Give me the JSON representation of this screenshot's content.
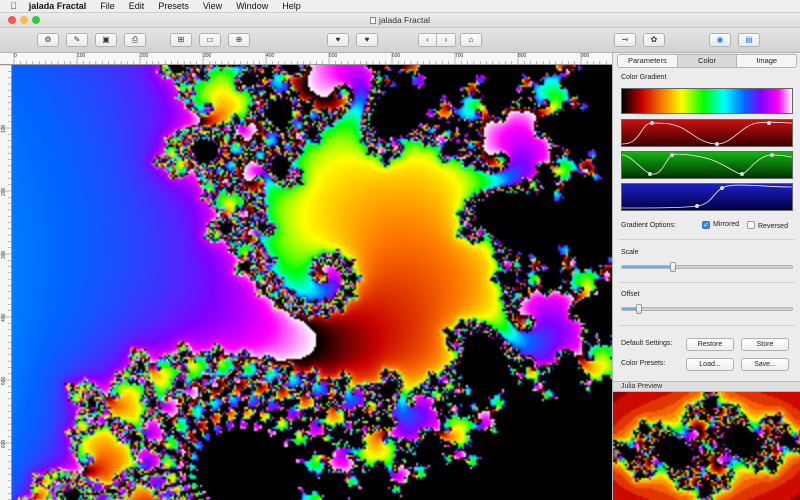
{
  "menubar": {
    "apple_icon": "apple-logo",
    "items": [
      "jalada Fractal",
      "File",
      "Edit",
      "Presets",
      "View",
      "Window",
      "Help"
    ]
  },
  "window": {
    "title": "jalada Fractal",
    "traffic_light_colors": {
      "close": "#fc5753",
      "minimize": "#fdbc40",
      "zoom": "#33c748"
    }
  },
  "toolbar": {
    "buttons": [
      {
        "name": "open-icon",
        "glyph": "⚙"
      },
      {
        "name": "edit-icon",
        "glyph": "✎"
      },
      {
        "name": "save-icon",
        "glyph": "▣"
      },
      {
        "name": "print-icon",
        "glyph": "⎙"
      },
      {
        "name": "export-icon",
        "glyph": "⊞"
      },
      {
        "name": "image-icon",
        "glyph": "▭"
      },
      {
        "name": "globe-icon",
        "glyph": "⊕"
      },
      {
        "name": "heart-icon",
        "glyph": "♥"
      },
      {
        "name": "heart-add-icon",
        "glyph": "♥"
      },
      {
        "name": "back-icon",
        "glyph": "‹"
      },
      {
        "name": "forward-icon",
        "glyph": "›"
      },
      {
        "name": "home-icon",
        "glyph": "⌂"
      },
      {
        "name": "pin-icon",
        "glyph": "⊸"
      },
      {
        "name": "palette-icon",
        "glyph": "✿"
      },
      {
        "name": "eye-icon",
        "glyph": "◉"
      },
      {
        "name": "toolbox-icon",
        "glyph": "▤"
      }
    ]
  },
  "rulers": {
    "top": [
      "0",
      "100",
      "200",
      "300",
      "400",
      "500",
      "600",
      "700",
      "800",
      "900"
    ],
    "left": [
      "100",
      "200",
      "300",
      "400",
      "500",
      "600"
    ]
  },
  "panel": {
    "tabs": [
      {
        "label": "Parameters",
        "active": false
      },
      {
        "label": "Color",
        "active": true
      },
      {
        "label": "Image",
        "active": false
      }
    ],
    "color_gradient_label": "Color Gradient",
    "gradient_options_label": "Gradient Options:",
    "mirrored_label": "Mirrored",
    "mirrored_checked": true,
    "reversed_label": "Reversed",
    "reversed_checked": false,
    "scale_label": "Scale",
    "scale_value": 0.3,
    "offset_label": "Offset",
    "offset_value": 0.1,
    "default_settings_label": "Default Settings:",
    "restore_label": "Restore",
    "store_label": "Store",
    "color_presets_label": "Color Presets:",
    "load_label": "Load...",
    "save_label": "Save...",
    "julia_preview_label": "Julia Preview",
    "accent_color": "#3d87ea"
  }
}
